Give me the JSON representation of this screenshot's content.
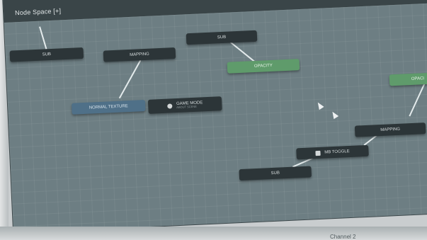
{
  "window": {
    "title": "Node Space [+]"
  },
  "nodes": {
    "sub_1": "SUB",
    "sub_2": "SUB",
    "sub_3": "SUB",
    "mapping_1": "MAPPING",
    "mapping_2": "MAPPING",
    "opacity_1": "OPACITY",
    "opacity_2": "OPACI",
    "normal_texture": "NORMAL TEXTURE",
    "game_mode": {
      "label": "GAME MODE",
      "sublabel": "ABOUT SCENE"
    },
    "mb_toggle": "MB TOGGLE"
  },
  "footer": {
    "tab_label": "Channel 2"
  },
  "colors": {
    "canvas": "#6d7e83",
    "node_dark": "#2c3538",
    "node_blue": "#4f7088",
    "node_green": "#5f9b6b",
    "wire": "#e4ebec"
  },
  "icons": [
    "pointer-cursor-icon",
    "sphere-icon",
    "camera-icon"
  ]
}
